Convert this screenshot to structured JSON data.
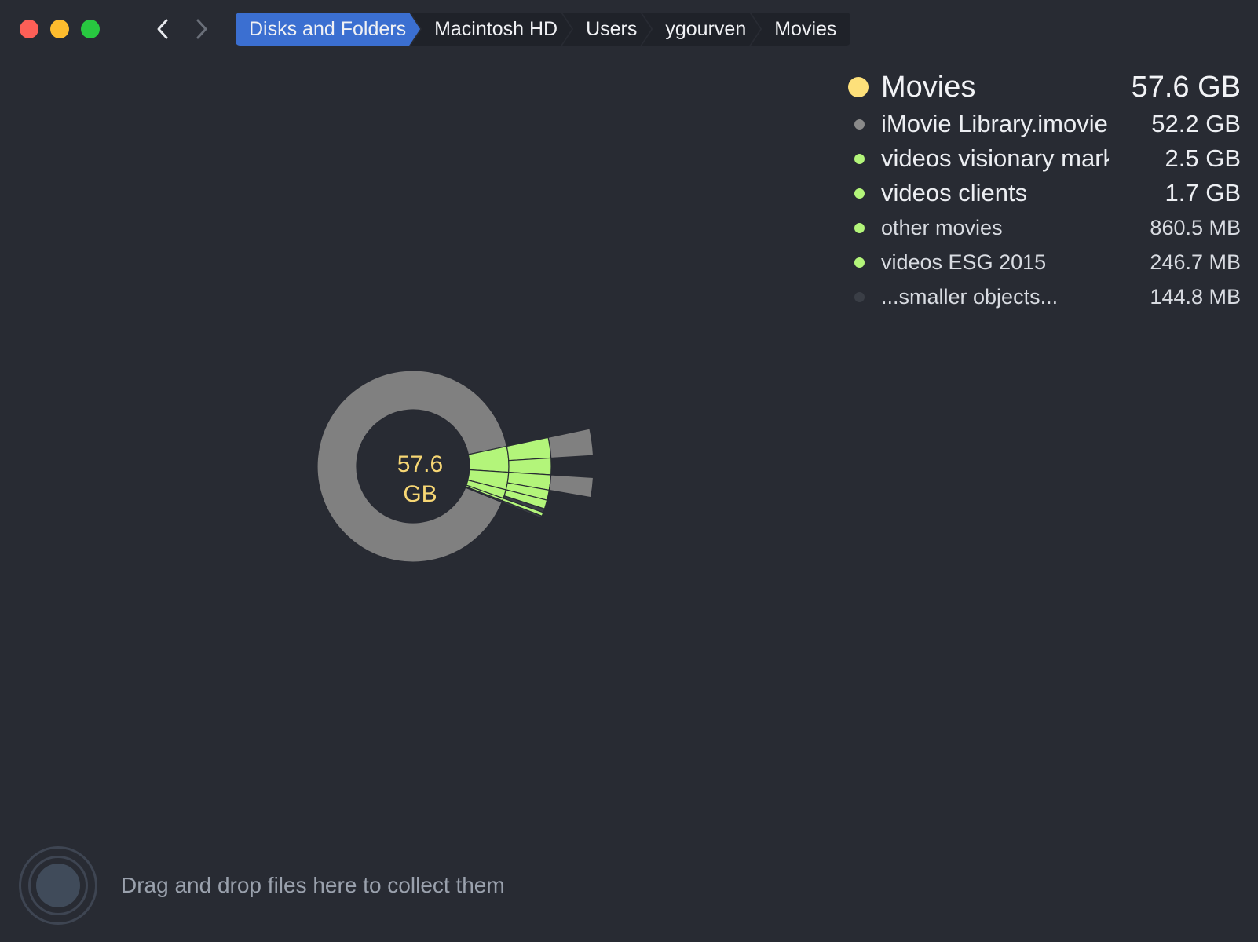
{
  "window": {
    "traffic_lights": [
      "close",
      "minimize",
      "zoom"
    ],
    "colors": {
      "close": "#fd5f57",
      "minimize": "#febc2e",
      "zoom": "#28c840"
    }
  },
  "nav": {
    "back_icon": "chevron-left-icon",
    "forward_icon": "chevron-right-icon"
  },
  "breadcrumb": {
    "items": [
      {
        "label": "Disks and Folders"
      },
      {
        "label": "Macintosh HD"
      },
      {
        "label": "Users"
      },
      {
        "label": "ygourven"
      },
      {
        "label": "Movies"
      }
    ],
    "active_color": "#3b6fd1"
  },
  "legend": {
    "header": {
      "name": "Movies",
      "size": "57.6 GB",
      "color": "#fde07a"
    },
    "items": [
      {
        "name": "iMovie Library.imovielibrary",
        "size": "52.2 GB",
        "color": "#8a8a8a"
      },
      {
        "name": "videos visionary marketing",
        "size": "2.5 GB",
        "color": "#b3f57a"
      },
      {
        "name": "videos clients",
        "size": "1.7 GB",
        "color": "#b3f57a"
      },
      {
        "name": "other movies",
        "size": "860.5  MB",
        "color": "#b3f57a"
      },
      {
        "name": "videos ESG 2015",
        "size": "246.7  MB",
        "color": "#b3f57a"
      },
      {
        "name": "...smaller objects...",
        "size": "144.8  MB",
        "color": "#3a3e46"
      }
    ]
  },
  "chart": {
    "center_label_line1": "57.6",
    "center_label_line2": "GB",
    "center_color": "#f7d774",
    "gray": "#808080",
    "green": "#b3f57a"
  },
  "chart_data": {
    "type": "pie",
    "categories": [
      "iMovie Library.imovielibrary",
      "videos visionary marketing",
      "videos clients",
      "other movies",
      "videos ESG 2015",
      "...smaller objects..."
    ],
    "values": [
      52.2,
      2.5,
      1.7,
      0.8605,
      0.2467,
      0.1448
    ]
  },
  "dropzone": {
    "text": "Drag and drop files here to collect them",
    "icon": "collector-icon"
  }
}
